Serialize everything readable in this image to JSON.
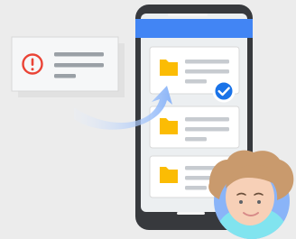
{
  "scene": {
    "alert_icon": "alert-circle-icon",
    "file_icon": "folder-icon",
    "check_icon": "check-circle-icon",
    "arrow_icon": "curved-arrow-icon",
    "avatar": "woman-avatar",
    "colors": {
      "background": "#ececec",
      "phone_body": "#37393d",
      "phone_screen": "#f1f3f4",
      "app_bar": "#4285f4",
      "card": "#ffffff",
      "placeholder_line": "#bdc1c6",
      "folder": "#fbbc04",
      "alert": "#ea4335",
      "check": "#1a73e8",
      "arrow_start": "#e8f0fe",
      "arrow_end": "#8ab4f8",
      "avatar_bg": "#8ab4f8",
      "hair": "#c99a6d",
      "skin": "#f7d0b7",
      "shirt": "#7fe3ef"
    }
  }
}
